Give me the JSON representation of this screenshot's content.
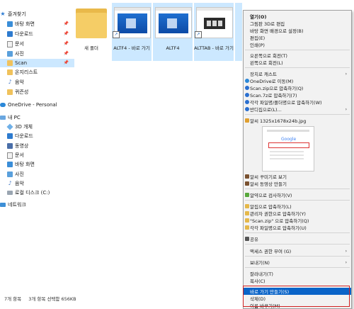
{
  "nav": {
    "quick_access": "즐겨찾기",
    "items": [
      {
        "label": "바탕 화면",
        "icon": "desktop-icon",
        "pinned": true
      },
      {
        "label": "다운로드",
        "icon": "download-icon",
        "pinned": true
      },
      {
        "label": "문서",
        "icon": "document-icon",
        "pinned": true
      },
      {
        "label": "사진",
        "icon": "pictures-icon",
        "pinned": true
      },
      {
        "label": "Scan",
        "icon": "folder-icon",
        "pinned": true,
        "selected": true
      },
      {
        "label": "온지리스트",
        "icon": "folder-icon"
      },
      {
        "label": "음악",
        "icon": "music-icon"
      },
      {
        "label": "퀴즌성",
        "icon": "folder-icon"
      }
    ],
    "onedrive": "OneDrive - Personal",
    "this_pc": "내 PC",
    "pc_items": [
      {
        "label": "3D 개체",
        "icon": "3d-objects-icon"
      },
      {
        "label": "다운로드",
        "icon": "download-icon"
      },
      {
        "label": "동영상",
        "icon": "video-icon"
      },
      {
        "label": "문서",
        "icon": "document-icon"
      },
      {
        "label": "바탕 화면",
        "icon": "desktop-icon"
      },
      {
        "label": "사진",
        "icon": "pictures-icon"
      },
      {
        "label": "음악",
        "icon": "music-icon"
      },
      {
        "label": "로컬 디스크 (C:)",
        "icon": "disk-icon"
      }
    ],
    "network": "네트워크",
    "pin_glyph": "📌"
  },
  "files": [
    {
      "name": "새 폴더",
      "type": "folder"
    },
    {
      "name": "ALTF4 - 바로 가기",
      "type": "shortcut"
    },
    {
      "name": "ALTF4",
      "type": "image"
    },
    {
      "name": "ALTTAB - 바로 가기",
      "type": "shortcut"
    }
  ],
  "status": {
    "count": "7개 항목",
    "selected": "3개 항목 선택함 656KB"
  },
  "menu": {
    "open": "열기(O)",
    "paint3d": "그림판 3D로 편집",
    "set_bg": "바탕 화면 배경으로 설정(B)",
    "edit": "편집(E)",
    "print": "인쇄(P)",
    "rotate_right": "오른쪽으로 회전(T)",
    "rotate_left": "왼쪽으로 회전(L)",
    "cast": "장치로 캐스트",
    "onedrive_move": "OneDrive로 이동(M)",
    "zip_compress": "Scan.zip으로 압축하기(Q)",
    "sevenz_compress": "Scan.7z로 압축하기(7)",
    "each_compress": "각각 파일명/폴더명으로 압축하기(W)",
    "bandizip": "반디집으로(L)...",
    "alsee_file": "알씨 1325x1678x24b.jpg",
    "alsee_decorate": "알씨 꾸미기로 보기",
    "alsee_video": "알씨 동영상 만들기",
    "alyac": "알약으로 검사하기(V)",
    "alzip_compress": "알집으로 압축하기(L)",
    "admin_compress": "관리자 권한으로 압축하기(Y)",
    "scan_zip_compress": "\"Scan.zip\" 으로 압축하기(Q)",
    "each_compress2": "각각 파일명으로 압축하기(U)",
    "share": "공유",
    "grant_access": "액세스 권한 부여 (G)",
    "send_to": "보내기(N)",
    "cut": "잘라내기(T)",
    "copy": "복사(C)",
    "create_shortcut": "바로 가기 만들기(S)",
    "delete": "삭제(D)",
    "rename": "이름 바꾸기(M)",
    "arrow": "›"
  },
  "preview_logo": "Google",
  "colors": {
    "highlight": "#0a64c8",
    "selection": "#cce8ff",
    "outline": "#d02020"
  }
}
